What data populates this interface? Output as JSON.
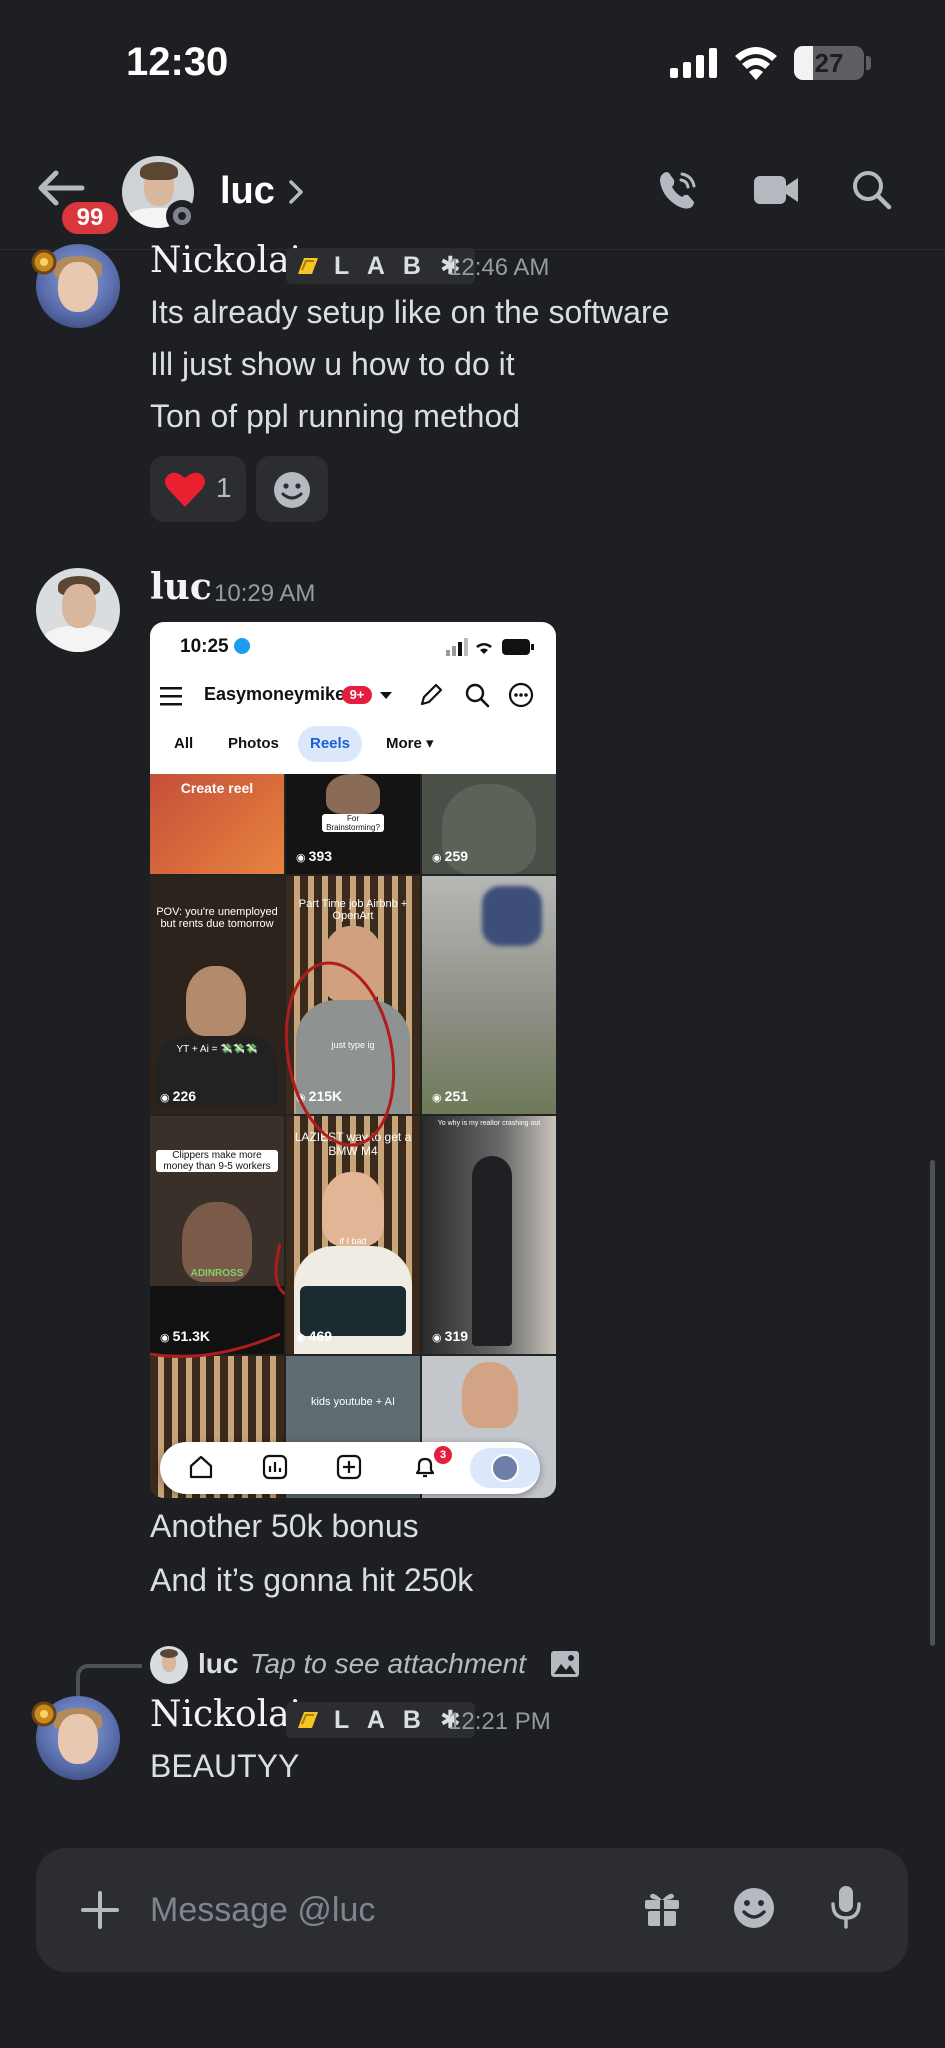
{
  "status_bar": {
    "time": "12:30",
    "battery": "27",
    "battery_level": 0.27
  },
  "header": {
    "unread_count": "99",
    "channel_name": "luc"
  },
  "messages": [
    {
      "author": "Nickolai",
      "tag": "L A B ✱",
      "timestamp": "12:46 AM",
      "lines": [
        "Its already setup like on the software",
        "Ill just show u how to do it",
        "Ton of ppl running method"
      ],
      "reaction": {
        "emoji": "heart",
        "count": "1"
      }
    },
    {
      "author": "luc",
      "timestamp": "10:29 AM",
      "attachment": {
        "time": "10:25",
        "account": "Easymoneymike",
        "badge": "9+",
        "tabs": [
          "All",
          "Photos",
          "Reels",
          "More ▾"
        ],
        "tiles": [
          {
            "caption": "Create reel",
            "views": ""
          },
          {
            "caption": "For Brainstorming?",
            "views": "393"
          },
          {
            "caption": "",
            "views": "259"
          },
          {
            "caption": "POV: you're unemployed but rents due tomorrow",
            "views": "226"
          },
          {
            "caption": "Part Time job Airbnb + OpenArt",
            "views": "215K"
          },
          {
            "caption": "",
            "views": "251"
          },
          {
            "caption": "Clippers make more money than 9-5 workers",
            "views": "51.3K"
          },
          {
            "caption": "LAZIEST way to get a BMW M4",
            "views": "469"
          },
          {
            "caption": "Yo why is my realtor crashing out",
            "views": "319"
          },
          {
            "caption": "",
            "views": ""
          },
          {
            "caption": "kids youtube + AI",
            "views": ""
          },
          {
            "caption": "",
            "views": ""
          }
        ],
        "overlay_texts": {
          "yt_ai": "YT + Ai = 💸💸💸",
          "adinross": "ADINROSS",
          "if_ibad": "if I bad",
          "rigo": "just type ig"
        },
        "notification_count": "3"
      },
      "lines": [
        "Another 50k bonus",
        "And it’s gonna hit 250k"
      ]
    },
    {
      "reply": {
        "author": "luc",
        "text": "Tap to see attachment"
      },
      "author": "Nickolai",
      "tag": "L A B ✱",
      "timestamp": "12:21 PM",
      "lines": [
        "BEAUTYY"
      ]
    }
  ],
  "composer": {
    "placeholder": "Message @luc"
  },
  "colors": {
    "background": "#1e1f22",
    "badge_red": "#da373c",
    "text": "#dbdee1",
    "muted": "#949ba4"
  }
}
